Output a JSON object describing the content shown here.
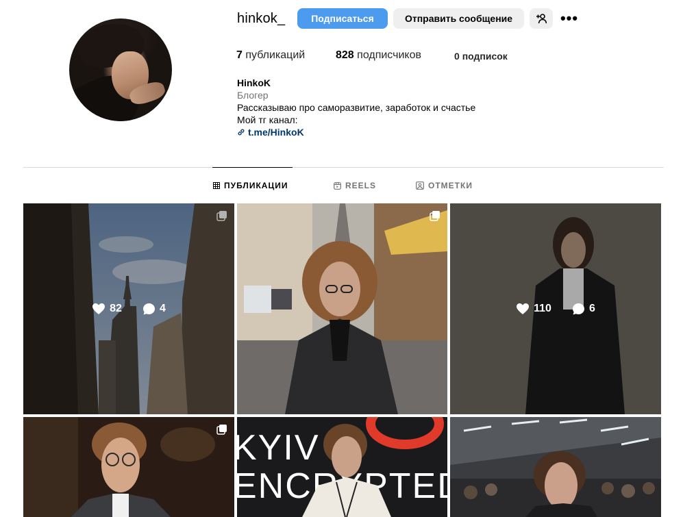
{
  "profile": {
    "username": "hinkok_",
    "follow_label": "Подписаться",
    "message_label": "Отправить сообщение",
    "more_label": "•••"
  },
  "stats": {
    "posts_count": "7",
    "posts_label": "публикаций",
    "followers_count": "828",
    "followers_label": "подписчиков",
    "following_count": "0",
    "following_label": "подписок"
  },
  "bio": {
    "name": "HinkoK",
    "category": "Блогер",
    "line1": "Рассказываю про саморазвитие, заработок и счастье",
    "line2": "Мой тг канал:",
    "link": "t.me/HinkoK"
  },
  "tabs": [
    {
      "label": "ПУБЛИКАЦИИ",
      "icon": "grid-icon",
      "active": true
    },
    {
      "label": "REELS",
      "icon": "reels-icon",
      "active": false
    },
    {
      "label": "ОТМЕТКИ",
      "icon": "tagged-icon",
      "active": false
    }
  ],
  "posts": [
    {
      "multiple": true,
      "likes": "82",
      "comments": "4",
      "hovered": true
    },
    {
      "multiple": true,
      "hovered": false
    },
    {
      "multiple": false,
      "likes": "110",
      "comments": "6",
      "hovered": true
    },
    {
      "multiple": true,
      "hovered": false
    },
    {
      "multiple": false,
      "hovered": false,
      "text_art": [
        "KYIV",
        "ENCRYPTED"
      ]
    },
    {
      "multiple": false,
      "hovered": false
    }
  ],
  "colors": {
    "follow_button": "#4c9bee",
    "link": "#00376b",
    "secondary_text": "#737373"
  }
}
